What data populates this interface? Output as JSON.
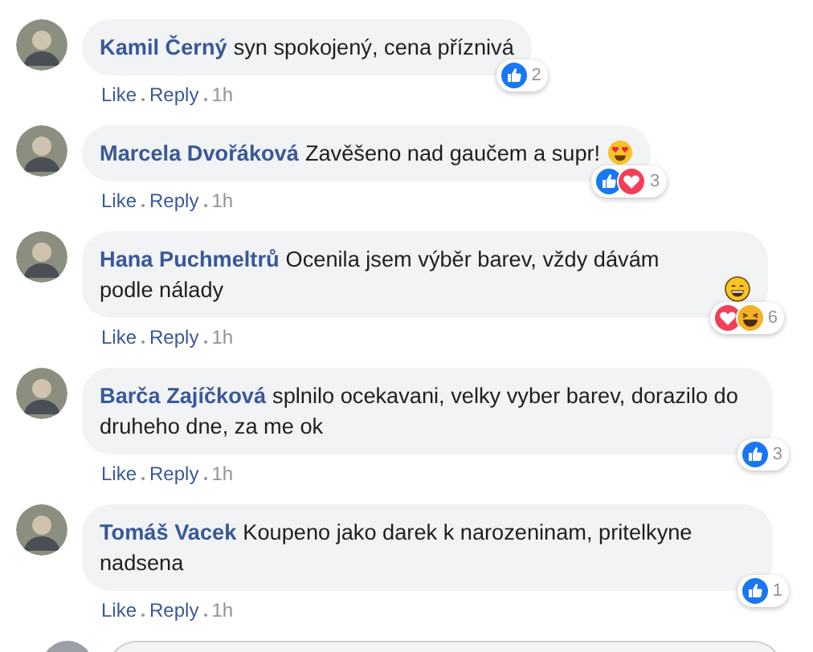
{
  "comments": [
    {
      "author": "Kamil Černý",
      "text": "syn spokojený, cena příznivá",
      "reactions": [
        {
          "kind": "like"
        }
      ],
      "reaction_count": "2",
      "actions": [
        "Like",
        "Reply"
      ],
      "time": "1h"
    },
    {
      "author": "Marcela Dvořáková",
      "text": "Zavěšeno nad gaučem a supr!",
      "trailing_icon": {
        "kind": "heart-eyes"
      },
      "reactions": [
        {
          "kind": "like"
        },
        {
          "kind": "love"
        }
      ],
      "reaction_count": "3",
      "actions": [
        "Like",
        "Reply"
      ],
      "time": "1h"
    },
    {
      "author": "Hana Puchmeltrů",
      "text": "Ocenila jsem výběr barev, vždy dávám podle nálady",
      "trailing_icon": {
        "kind": "grin"
      },
      "reactions": [
        {
          "kind": "love"
        },
        {
          "kind": "haha"
        }
      ],
      "reaction_count": "6",
      "actions": [
        "Like",
        "Reply"
      ],
      "time": "1h"
    },
    {
      "author": "Barča Zajíčková",
      "text": "splnilo ocekavani, velky vyber barev, dorazilo do druheho dne, za me ok",
      "reactions": [
        {
          "kind": "like"
        }
      ],
      "reaction_count": "3",
      "actions": [
        "Like",
        "Reply"
      ],
      "time": "1h"
    },
    {
      "author": "Tomáš Vacek",
      "text": "Koupeno jako darek k narozeninam, pritelkyne nadsena",
      "reactions": [
        {
          "kind": "like"
        }
      ],
      "reaction_count": "1",
      "actions": [
        "Like",
        "Reply"
      ],
      "time": "1h"
    }
  ]
}
